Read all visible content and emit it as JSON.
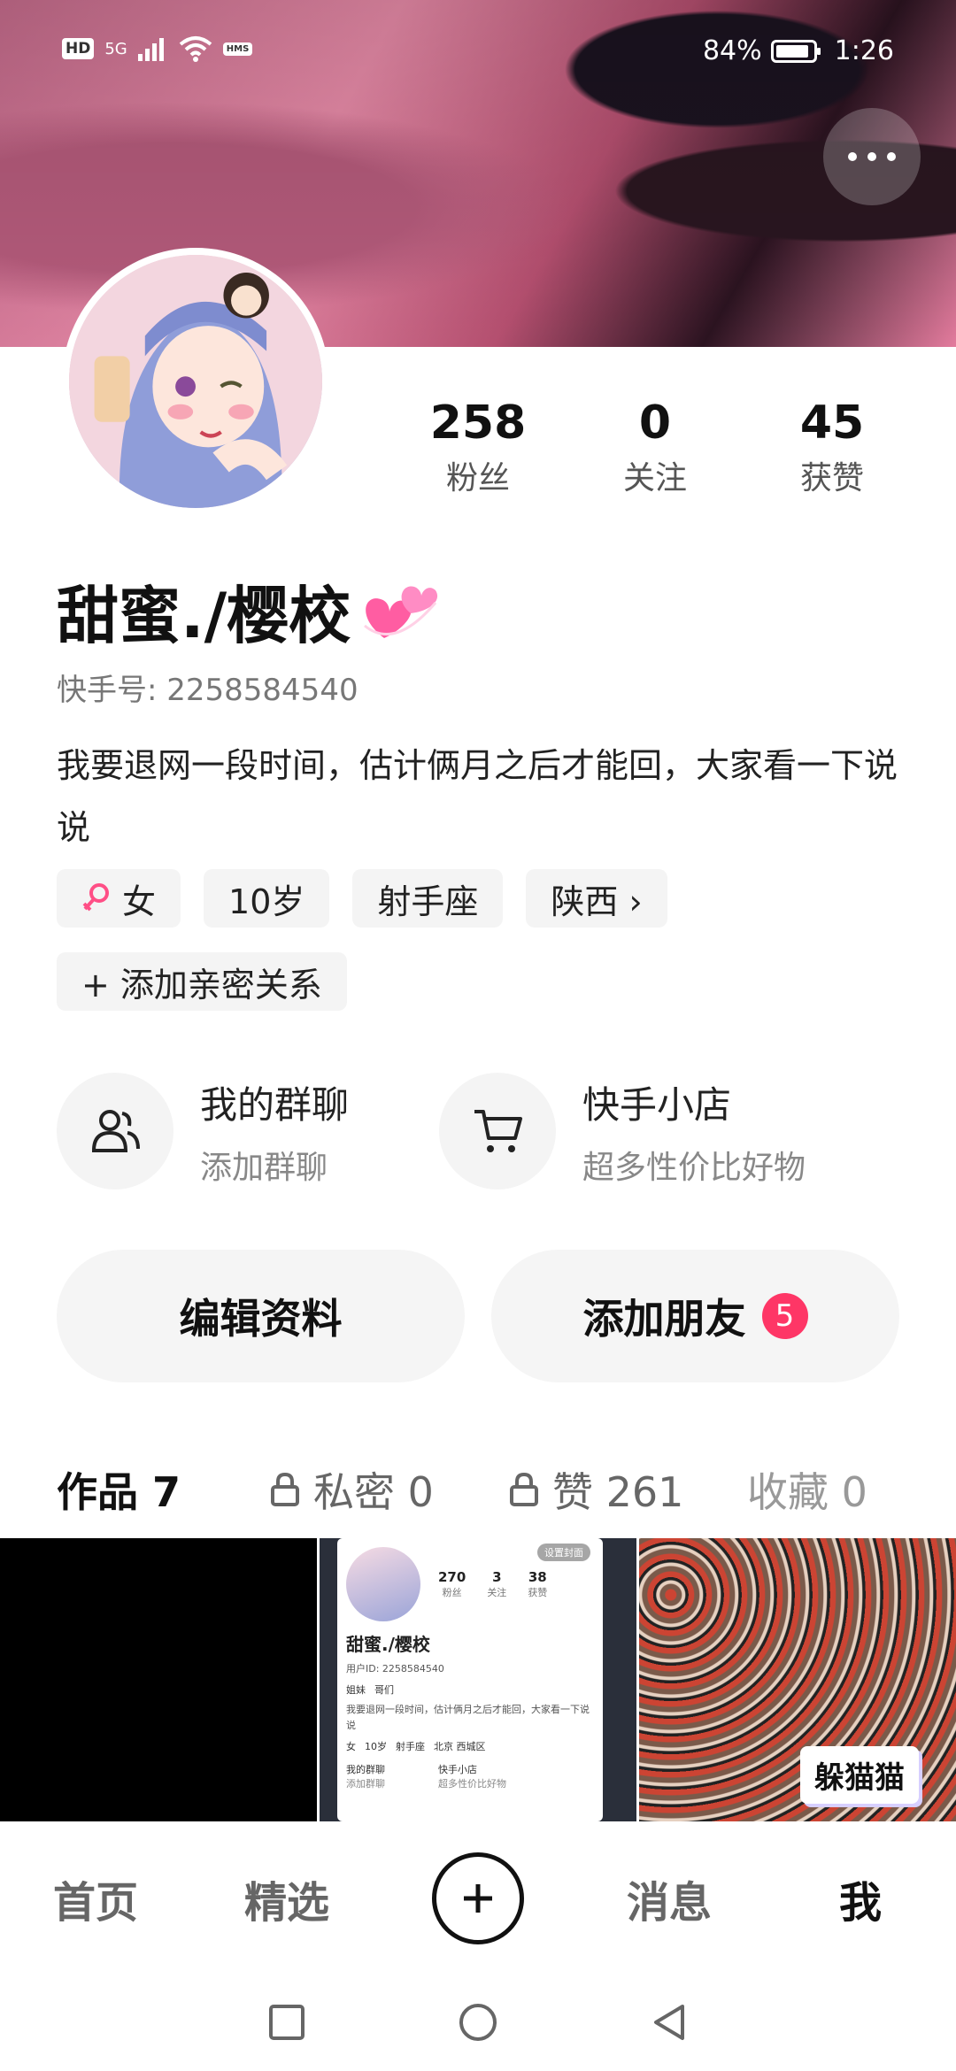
{
  "status_bar": {
    "signal": "5G",
    "battery_percent": "84%",
    "time": "1:26",
    "hd_label": "HD",
    "hms_label": "HMS"
  },
  "header": {
    "more_icon": "ellipsis-icon"
  },
  "profile": {
    "stats": [
      {
        "value": "258",
        "label": "粉丝"
      },
      {
        "value": "0",
        "label": "关注"
      },
      {
        "value": "45",
        "label": "获赞"
      }
    ],
    "name": "甜蜜./樱校",
    "kuaishou_id": "快手号: 2258584540",
    "bio": "我要退网一段时间，估计俩月之后才能回，大家看一下说说",
    "tags": [
      {
        "label": "女",
        "icon": "female-icon"
      },
      {
        "label": "10岁"
      },
      {
        "label": "射手座"
      },
      {
        "label": "陕西 ›"
      }
    ],
    "add_relation": "+ 添加亲密关系"
  },
  "features": [
    {
      "title": "我的群聊",
      "subtitle": "添加群聊",
      "icon": "group-icon"
    },
    {
      "title": "快手小店",
      "subtitle": "超多性价比好物",
      "icon": "cart-icon"
    }
  ],
  "actions": {
    "edit_profile": "编辑资料",
    "add_friend": "添加朋友",
    "add_friend_badge": "5"
  },
  "tabs": [
    {
      "label": "作品 7",
      "active": true
    },
    {
      "label": "私密 0",
      "locked": true
    },
    {
      "label": "赞 261",
      "locked": true
    },
    {
      "label": "收藏 0"
    }
  ],
  "grid": {
    "mini_profile": {
      "stats": [
        {
          "value": "270",
          "label": "粉丝"
        },
        {
          "value": "3",
          "label": "关注"
        },
        {
          "value": "38",
          "label": "获赞"
        }
      ],
      "name": "甜蜜./樱校",
      "uid": "用户ID: 2258584540",
      "friends": [
        "姐妹",
        "哥们"
      ],
      "bio": "我要退网一段时间，估计俩月之后才能回，大家看一下说说",
      "tags": [
        "女",
        "10岁",
        "射手座",
        "北京 西城区"
      ],
      "features": [
        "我的群聊",
        "快手小店"
      ],
      "feature_subs": [
        "添加群聊",
        "超多性价比好物"
      ],
      "cover_chip": "设置封面"
    },
    "game_label": "躲猫猫"
  },
  "bottom_nav": {
    "items": [
      "首页",
      "精选",
      "消息",
      "我"
    ],
    "active": "我"
  }
}
